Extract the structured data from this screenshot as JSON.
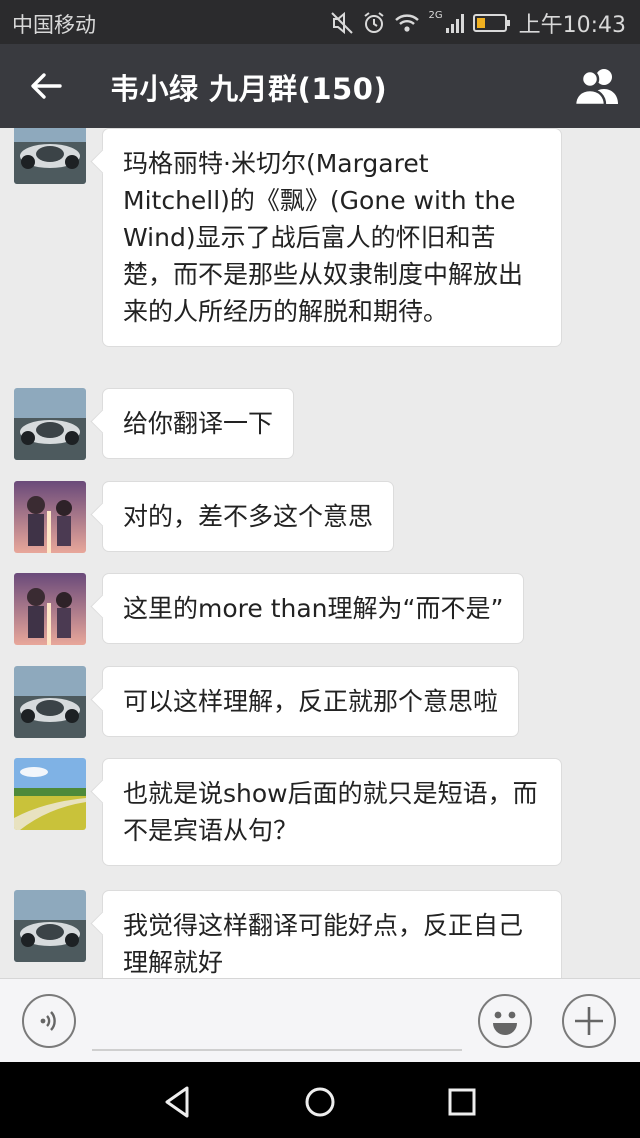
{
  "status_bar": {
    "carrier": "中国移动",
    "network": "2G",
    "time": "上午10:43"
  },
  "title_bar": {
    "title": "韦小绿  九月群(150)",
    "back_icon": "back-arrow-icon",
    "members_icon": "group-members-icon"
  },
  "messages": [
    {
      "avatar": "race-car",
      "text": "玛格丽特·米切尔(Margaret Mitchell)的《飘》(Gone with the Wind)显示了战后富人的怀旧和苦楚，而不是那些从奴隶制度中解放出来的人所经历的解脱和期待。"
    },
    {
      "avatar": "race-car",
      "text": "给你翻译一下"
    },
    {
      "avatar": "anime-couple",
      "text": "对的，差不多这个意思"
    },
    {
      "avatar": "anime-couple",
      "text": "这里的more than理解为“而不是”"
    },
    {
      "avatar": "race-car",
      "text": "可以这样理解，反正就那个意思啦"
    },
    {
      "avatar": "field-landscape",
      "text": "也就是说show后面的就只是短语，而不是宾语从句？"
    },
    {
      "avatar": "race-car",
      "text": "我觉得这样翻译可能好点，反正自己理解就好"
    }
  ],
  "input_bar": {
    "voice_icon": "voice-icon",
    "emoji_icon": "emoji-icon",
    "plus_icon": "plus-icon"
  },
  "nav_bar": {
    "back_icon": "nav-back-icon",
    "home_icon": "nav-home-icon",
    "recents_icon": "nav-recents-icon"
  },
  "colors": {
    "status_bar_bg": "#2b2b2d",
    "title_bar_bg": "#393a3f",
    "chat_bg": "#ebebeb",
    "bubble_bg": "#ffffff"
  }
}
